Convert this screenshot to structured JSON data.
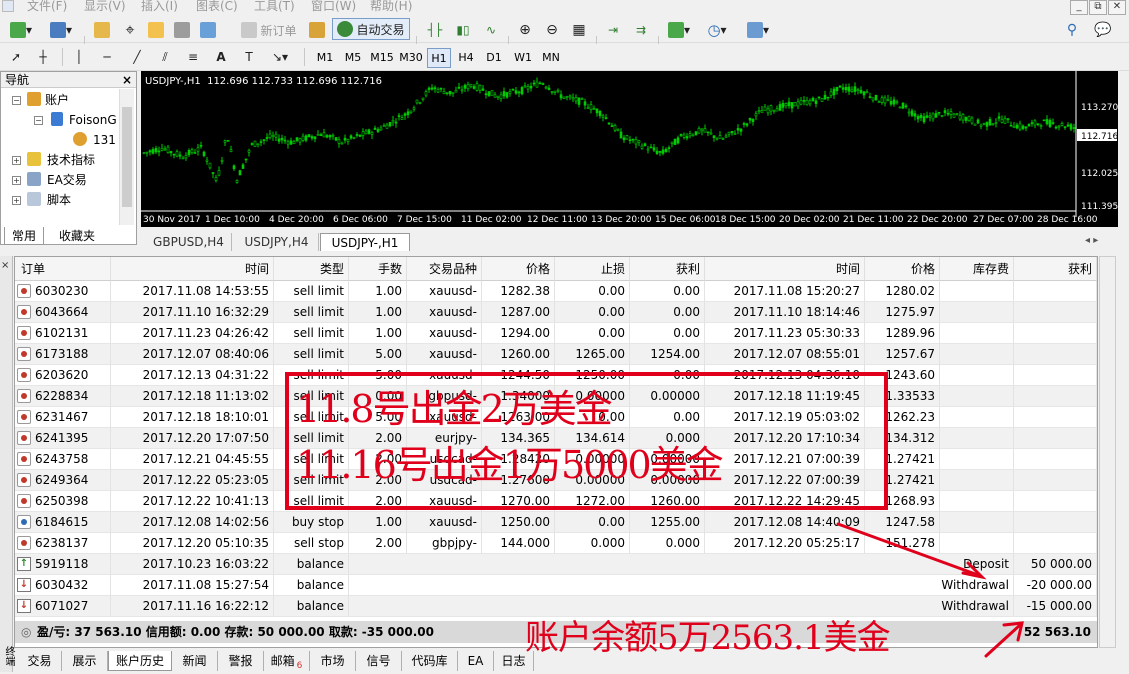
{
  "menu": [
    "文件(F)",
    "显示(V)",
    "插入(I)",
    "图表(C)",
    "工具(T)",
    "窗口(W)",
    "帮助(H)"
  ],
  "window_buttons": [
    "_",
    "⧉",
    "✕"
  ],
  "toolbar": {
    "new_order": "新订单",
    "auto_trade": "自动交易"
  },
  "timeframes": [
    "M1",
    "M5",
    "M15",
    "M30",
    "H1",
    "H4",
    "D1",
    "W1",
    "MN"
  ],
  "active_timeframe": "H1",
  "navigator": {
    "title": "导航",
    "close": "×",
    "items": [
      {
        "label": "账户"
      },
      {
        "label": "FoisonG"
      },
      {
        "label": "131"
      },
      {
        "label": "技术指标"
      },
      {
        "label": "EA交易"
      },
      {
        "label": "脚本"
      }
    ],
    "tabs": [
      "常用",
      "收藏夹"
    ]
  },
  "chart": {
    "header": "USDJPY-,H1  112.696 112.733 112.696 112.716",
    "price_labels": [
      "113.270",
      "112.716",
      "112.025",
      "111.395"
    ],
    "current_price": "112.716",
    "time_labels": [
      "30 Nov 2017",
      "1 Dec 10:00",
      "4 Dec 20:00",
      "6 Dec 06:00",
      "7 Dec 15:00",
      "11 Dec 02:00",
      "12 Dec 11:00",
      "13 Dec 20:00",
      "15 Dec 06:00",
      "18 Dec 15:00",
      "20 Dec 02:00",
      "21 Dec 11:00",
      "22 Dec 20:00",
      "27 Dec 07:00",
      "28 Dec 16:00"
    ],
    "colors": {
      "candles": "#00cc00",
      "background": "#000000",
      "axis_text": "#ffffff"
    }
  },
  "chart_tabs": [
    "GBPUSD,H4",
    "USDJPY,H4",
    "USDJPY-,H1"
  ],
  "active_chart_tab": "USDJPY-,H1",
  "terminal": {
    "headers": [
      "订单",
      "时间",
      "类型",
      "手数",
      "交易品种",
      "价格",
      "止损",
      "获利",
      "时间",
      "价格",
      "库存费",
      "获利"
    ],
    "sort_arrow": "/",
    "rows": [
      {
        "order": "6030230",
        "open_time": "2017.11.08 14:53:55",
        "type": "sell limit",
        "lots": "1.00",
        "symbol": "xauusd-",
        "price": "1282.38",
        "sl": "0.00",
        "tp": "0.00",
        "close_time": "2017.11.08 15:20:27",
        "close_price": "1280.02",
        "swap": "",
        "profit": "",
        "icon": "order-red"
      },
      {
        "order": "6043664",
        "open_time": "2017.11.10 16:32:29",
        "type": "sell limit",
        "lots": "1.00",
        "symbol": "xauusd-",
        "price": "1287.00",
        "sl": "0.00",
        "tp": "0.00",
        "close_time": "2017.11.10 18:14:46",
        "close_price": "1275.97",
        "swap": "",
        "profit": "",
        "icon": "order-red"
      },
      {
        "order": "6102131",
        "open_time": "2017.11.23 04:26:42",
        "type": "sell limit",
        "lots": "1.00",
        "symbol": "xauusd-",
        "price": "1294.00",
        "sl": "0.00",
        "tp": "0.00",
        "close_time": "2017.11.23 05:30:33",
        "close_price": "1289.96",
        "swap": "",
        "profit": "",
        "icon": "order-red"
      },
      {
        "order": "6173188",
        "open_time": "2017.12.07 08:40:06",
        "type": "sell limit",
        "lots": "5.00",
        "symbol": "xauusd-",
        "price": "1260.00",
        "sl": "1265.00",
        "tp": "1254.00",
        "close_time": "2017.12.07 08:55:01",
        "close_price": "1257.67",
        "swap": "",
        "profit": "",
        "icon": "order-red"
      },
      {
        "order": "6203620",
        "open_time": "2017.12.13 04:31:22",
        "type": "sell limit",
        "lots": "5.00",
        "symbol": "xauusd-",
        "price": "1244.50",
        "sl": "1250.00",
        "tp": "0.00",
        "close_time": "2017.12.13 04:36:10",
        "close_price": "1243.60",
        "swap": "",
        "profit": "",
        "icon": "order-red"
      },
      {
        "order": "6228834",
        "open_time": "2017.12.18 11:13:02",
        "type": "sell limit",
        "lots": "0.00",
        "symbol": "gbpusd-",
        "price": "1.34000",
        "sl": "0.00000",
        "tp": "0.00000",
        "close_time": "2017.12.18 11:19:45",
        "close_price": "1.33533",
        "swap": "",
        "profit": "",
        "icon": "order-red"
      },
      {
        "order": "6231467",
        "open_time": "2017.12.18 18:10:01",
        "type": "sell limit",
        "lots": "5.00",
        "symbol": "xauusd-",
        "price": "1263.00",
        "sl": "0.00",
        "tp": "0.00",
        "close_time": "2017.12.19 05:03:02",
        "close_price": "1262.23",
        "swap": "",
        "profit": "",
        "icon": "order-red"
      },
      {
        "order": "6241395",
        "open_time": "2017.12.20 17:07:50",
        "type": "sell limit",
        "lots": "2.00",
        "symbol": "eurjpy-",
        "price": "134.365",
        "sl": "134.614",
        "tp": "0.000",
        "close_time": "2017.12.20 17:10:34",
        "close_price": "134.312",
        "swap": "",
        "profit": "",
        "icon": "order-red"
      },
      {
        "order": "6243758",
        "open_time": "2017.12.21 04:45:55",
        "type": "sell limit",
        "lots": "2.00",
        "symbol": "usdcad-",
        "price": "1.28420",
        "sl": "0.00000",
        "tp": "0.00000",
        "close_time": "2017.12.21 07:00:39",
        "close_price": "1.27421",
        "swap": "",
        "profit": "",
        "icon": "order-red"
      },
      {
        "order": "6249364",
        "open_time": "2017.12.22 05:23:05",
        "type": "sell limit",
        "lots": "2.00",
        "symbol": "usdcad-",
        "price": "1.27600",
        "sl": "0.00000",
        "tp": "0.00000",
        "close_time": "2017.12.22 07:00:39",
        "close_price": "1.27421",
        "swap": "",
        "profit": "",
        "icon": "order-red"
      },
      {
        "order": "6250398",
        "open_time": "2017.12.22 10:41:13",
        "type": "sell limit",
        "lots": "2.00",
        "symbol": "xauusd-",
        "price": "1270.00",
        "sl": "1272.00",
        "tp": "1260.00",
        "close_time": "2017.12.22 14:29:45",
        "close_price": "1268.93",
        "swap": "",
        "profit": "",
        "icon": "order-red"
      },
      {
        "order": "6184615",
        "open_time": "2017.12.08 14:02:56",
        "type": "buy stop",
        "lots": "1.00",
        "symbol": "xauusd-",
        "price": "1250.00",
        "sl": "0.00",
        "tp": "1255.00",
        "close_time": "2017.12.08 14:40:09",
        "close_price": "1247.58",
        "swap": "",
        "profit": "",
        "icon": "order-blue"
      },
      {
        "order": "6238137",
        "open_time": "2017.12.20 05:10:35",
        "type": "sell stop",
        "lots": "2.00",
        "symbol": "gbpjpy-",
        "price": "144.000",
        "sl": "0.000",
        "tp": "0.000",
        "close_time": "2017.12.20 05:25:17",
        "close_price": "151.278",
        "swap": "",
        "profit": "",
        "icon": "order-red"
      }
    ],
    "balance_rows": [
      {
        "order": "5919118",
        "time": "2017.10.23 16:03:22",
        "type": "balance",
        "comment": "Deposit",
        "profit": "50 000.00",
        "icon": "deposit"
      },
      {
        "order": "6030432",
        "time": "2017.11.08 15:27:54",
        "type": "balance",
        "comment": "Withdrawal",
        "profit": "-20 000.00",
        "icon": "withdrawal"
      },
      {
        "order": "6071027",
        "time": "2017.11.16 16:22:12",
        "type": "balance",
        "comment": "Withdrawal",
        "profit": "-15 000.00",
        "icon": "withdrawal"
      }
    ],
    "summary": "盈/亏: 37 563.10  信用额: 0.00  存款: 50 000.00  取款: -35 000.00",
    "summary_total": "52 563.10"
  },
  "bottom_tabs": [
    "交易",
    "展示",
    "账户历史",
    "新闻",
    "警报",
    "邮箱",
    "市场",
    "信号",
    "代码库",
    "EA",
    "日志"
  ],
  "active_bottom_tab": "账户历史",
  "mailbox_badge": "6",
  "side_label": "终端",
  "annotations": {
    "line1": "11.8号出金2万美金",
    "line2": "11.16号出金1万5000美金",
    "line3": "账户余额5万2563.1美金",
    "color": "#e0001b"
  }
}
